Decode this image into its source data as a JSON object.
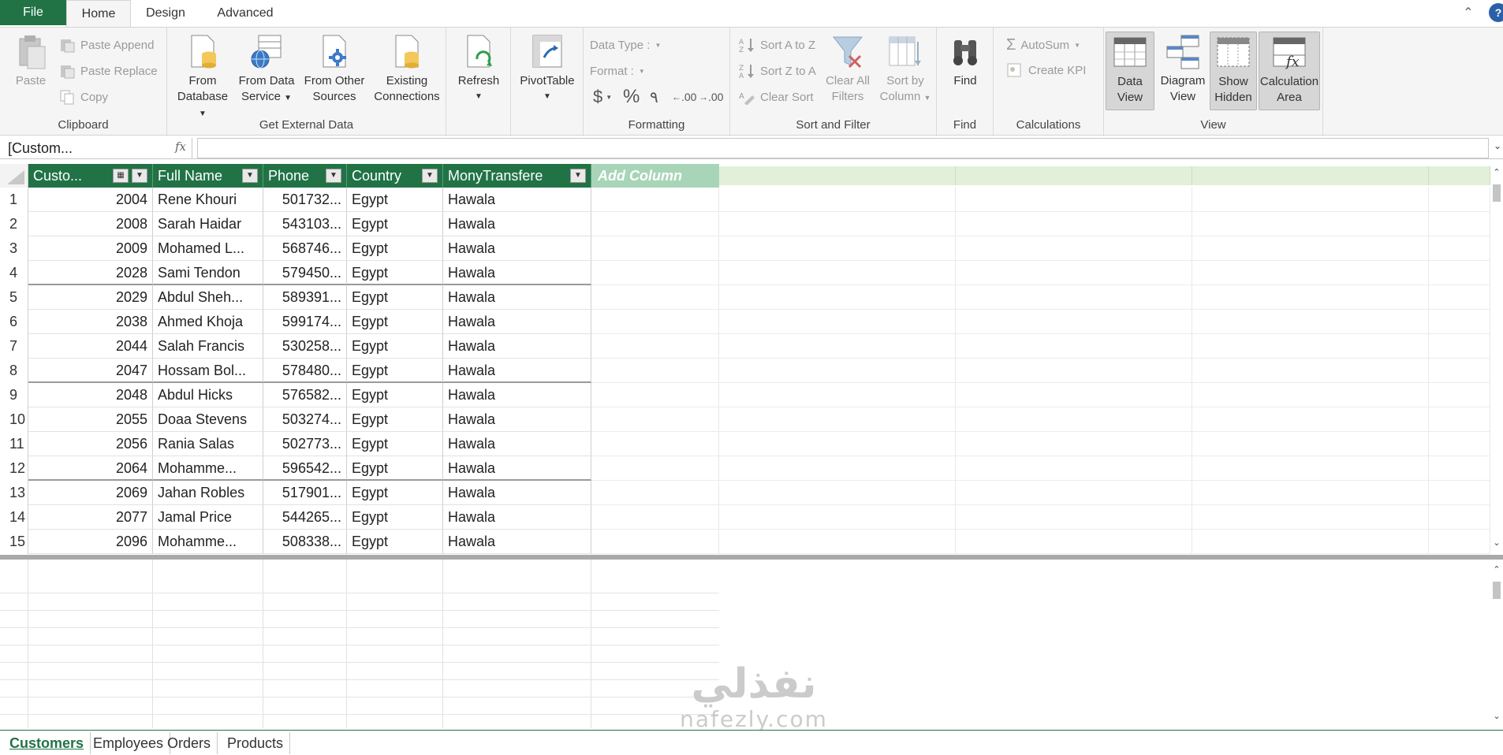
{
  "tabs": {
    "file": "File",
    "home": "Home",
    "design": "Design",
    "advanced": "Advanced",
    "help": "?"
  },
  "ribbon": {
    "clipboard": {
      "label": "Clipboard",
      "paste": "Paste",
      "paste_append": "Paste Append",
      "paste_replace": "Paste Replace",
      "copy": "Copy"
    },
    "external": {
      "label": "Get External Data",
      "from_database": [
        "From",
        "Database"
      ],
      "from_data_service": [
        "From Data",
        "Service"
      ],
      "from_other_sources": [
        "From Other",
        "Sources"
      ],
      "existing_connections": [
        "Existing",
        "Connections"
      ]
    },
    "refresh": "Refresh",
    "pivottable": "PivotTable",
    "formatting": {
      "label": "Formatting",
      "data_type": "Data Type :",
      "format": "Format :",
      "currency": "$",
      "percent": "%",
      "comma": "٩",
      "inc_decimal": ".00",
      "dec_decimal": ".00"
    },
    "sort_filter": {
      "label": "Sort and Filter",
      "sort_az": "Sort A to Z",
      "sort_za": "Sort Z to A",
      "clear_sort": "Clear Sort",
      "clear_filters": [
        "Clear All",
        "Filters"
      ],
      "sort_by_column": [
        "Sort by",
        "Column"
      ]
    },
    "find": {
      "label": "Find",
      "button": "Find"
    },
    "calculations": {
      "label": "Calculations",
      "autosum": "AutoSum",
      "create_kpi": "Create KPI"
    },
    "view": {
      "label": "View",
      "data_view": [
        "Data",
        "View"
      ],
      "diagram_view": [
        "Diagram",
        "View"
      ],
      "show_hidden": [
        "Show",
        "Hidden"
      ],
      "calculation_area": [
        "Calculation",
        "Area"
      ]
    }
  },
  "formula_bar": {
    "name_box": "[Custom...",
    "fx": "fx",
    "formula": ""
  },
  "table": {
    "columns": [
      "Custo...",
      "Full Name",
      "Phone",
      "Country",
      "MonyTransfere"
    ],
    "add_column": "Add Column",
    "rows": [
      {
        "n": "1",
        "id": "2004",
        "name": "Rene Khouri",
        "phone": "501732...",
        "country": "Egypt",
        "transfer": "Hawala"
      },
      {
        "n": "2",
        "id": "2008",
        "name": "Sarah Haidar",
        "phone": "543103...",
        "country": "Egypt",
        "transfer": "Hawala"
      },
      {
        "n": "3",
        "id": "2009",
        "name": "Mohamed L...",
        "phone": "568746...",
        "country": "Egypt",
        "transfer": "Hawala"
      },
      {
        "n": "4",
        "id": "2028",
        "name": "Sami Tendon",
        "phone": "579450...",
        "country": "Egypt",
        "transfer": "Hawala"
      },
      {
        "n": "5",
        "id": "2029",
        "name": "Abdul Sheh...",
        "phone": "589391...",
        "country": "Egypt",
        "transfer": "Hawala"
      },
      {
        "n": "6",
        "id": "2038",
        "name": "Ahmed Khoja",
        "phone": "599174...",
        "country": "Egypt",
        "transfer": "Hawala"
      },
      {
        "n": "7",
        "id": "2044",
        "name": "Salah Francis",
        "phone": "530258...",
        "country": "Egypt",
        "transfer": "Hawala"
      },
      {
        "n": "8",
        "id": "2047",
        "name": "Hossam Bol...",
        "phone": "578480...",
        "country": "Egypt",
        "transfer": "Hawala"
      },
      {
        "n": "9",
        "id": "2048",
        "name": "Abdul Hicks",
        "phone": "576582...",
        "country": "Egypt",
        "transfer": "Hawala"
      },
      {
        "n": "10",
        "id": "2055",
        "name": "Doaa Stevens",
        "phone": "503274...",
        "country": "Egypt",
        "transfer": "Hawala"
      },
      {
        "n": "11",
        "id": "2056",
        "name": "Rania Salas",
        "phone": "502773...",
        "country": "Egypt",
        "transfer": "Hawala"
      },
      {
        "n": "12",
        "id": "2064",
        "name": "Mohamme...",
        "phone": "596542...",
        "country": "Egypt",
        "transfer": "Hawala"
      },
      {
        "n": "13",
        "id": "2069",
        "name": "Jahan Robles",
        "phone": "517901...",
        "country": "Egypt",
        "transfer": "Hawala"
      },
      {
        "n": "14",
        "id": "2077",
        "name": "Jamal Price",
        "phone": "544265...",
        "country": "Egypt",
        "transfer": "Hawala"
      },
      {
        "n": "15",
        "id": "2096",
        "name": "Mohamme...",
        "phone": "508338...",
        "country": "Egypt",
        "transfer": "Hawala"
      }
    ]
  },
  "watermark": {
    "arabic": "نفذلي",
    "latin": "nafezly.com"
  },
  "sheets": [
    "Customers",
    "Employees",
    "Orders",
    "Products"
  ],
  "colors": {
    "accent": "#217346",
    "add_column": "#a8d5b8"
  }
}
